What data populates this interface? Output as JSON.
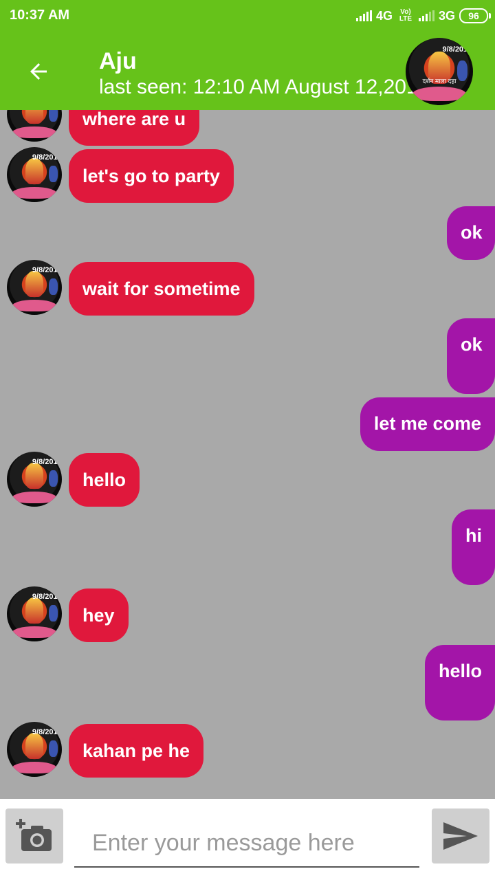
{
  "status_bar": {
    "time": "10:37 AM",
    "network_1": "4G",
    "volte": "Vo) LTE",
    "network_2": "3G",
    "battery": "96"
  },
  "header": {
    "contact_name": "Aju",
    "last_seen": "last seen: 12:10 AM August 12,2019",
    "back_icon": "arrow-left-icon",
    "avatar_date": "9/8/201",
    "avatar_caption": "दर्शन माला दहा"
  },
  "messages": [
    {
      "from": "them",
      "text": "where are u"
    },
    {
      "from": "them",
      "text": "let's go to party"
    },
    {
      "from": "me",
      "text": "ok"
    },
    {
      "from": "them",
      "text": "wait for sometime"
    },
    {
      "from": "me",
      "text": "ok"
    },
    {
      "from": "me",
      "text": "let me come"
    },
    {
      "from": "them",
      "text": "hello"
    },
    {
      "from": "me",
      "text": "hi"
    },
    {
      "from": "them",
      "text": "hey"
    },
    {
      "from": "me",
      "text": "hello"
    },
    {
      "from": "them",
      "text": "kahan pe he"
    }
  ],
  "composer": {
    "placeholder": "Enter your message here",
    "camera_icon": "add-photo-camera-icon",
    "send_icon": "send-icon"
  },
  "colors": {
    "header_green": "#66c21a",
    "chat_background": "#a9a9a9",
    "incoming_bubble": "#e0183c",
    "outgoing_bubble": "#a315a8"
  }
}
